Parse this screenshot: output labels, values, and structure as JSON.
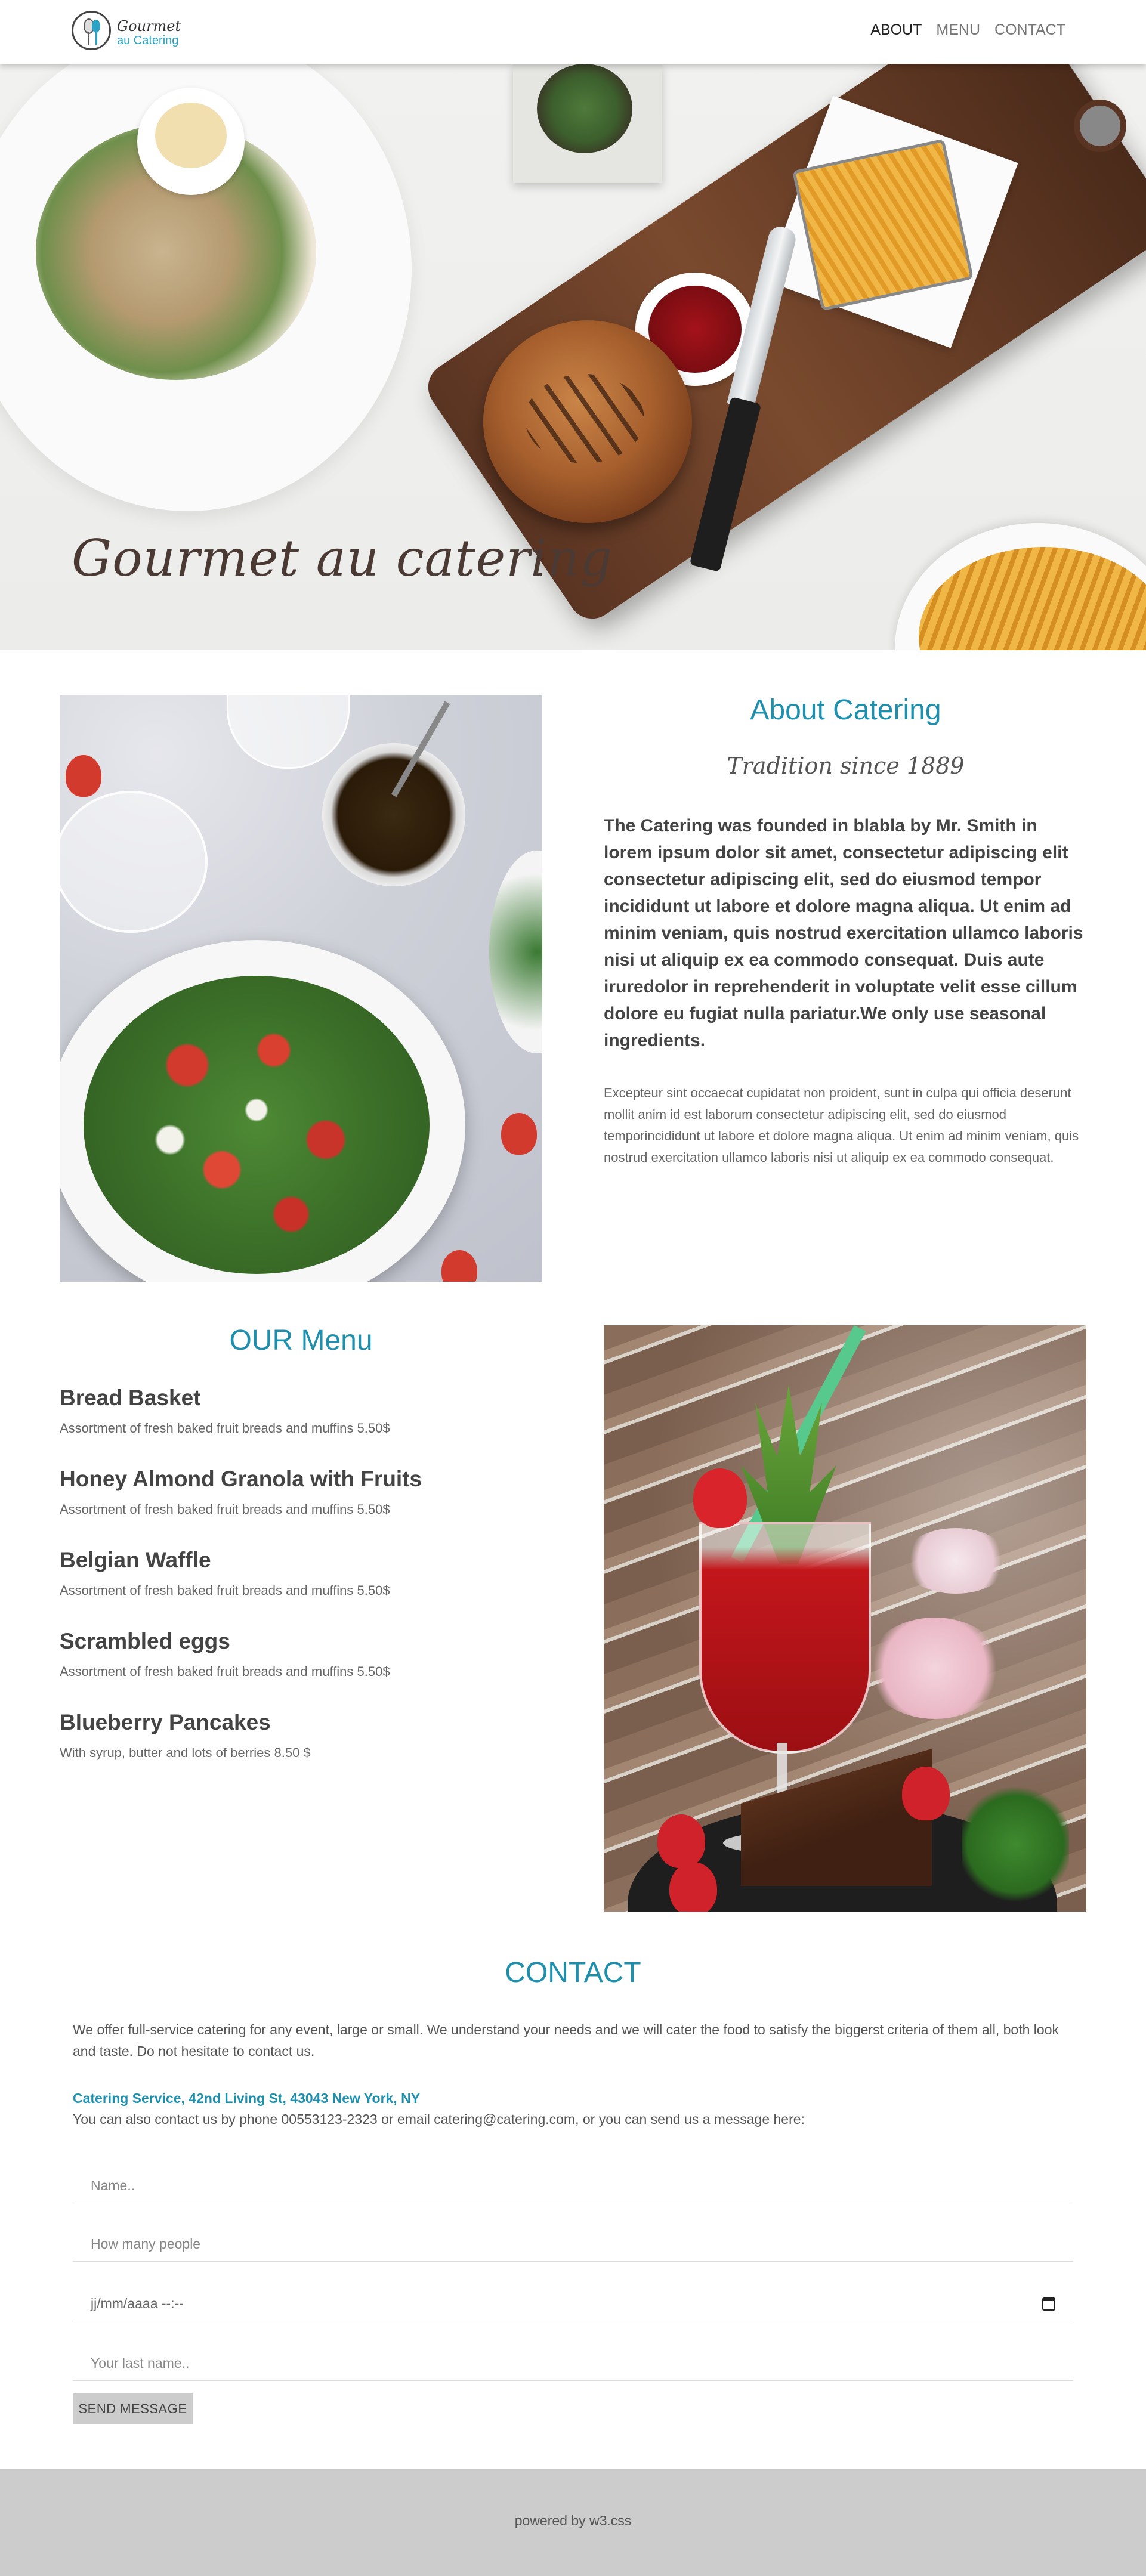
{
  "navbar": {
    "logo": {
      "line1": "Gourmet",
      "line2": "au Catering"
    },
    "links": [
      {
        "label": "ABOUT",
        "active": true
      },
      {
        "label": "MENU",
        "active": false
      },
      {
        "label": "CONTACT",
        "active": false
      }
    ]
  },
  "hero": {
    "title": "Gourmet au catering"
  },
  "about": {
    "title": "About Catering",
    "subtitle": "Tradition since 1889",
    "bold_text": "The Catering was founded in blabla by Mr. Smith in lorem ipsum dolor sit amet, consectetur adipiscing elit consectetur adipiscing elit, sed do eiusmod tempor incididunt ut labore et dolore magna aliqua. Ut enim ad minim veniam, quis nostrud exercitation ullamco laboris nisi ut aliquip ex ea commodo consequat. Duis aute iruredolor in reprehenderit in voluptate velit esse cillum dolore eu fugiat nulla pariatur.We only use seasonal ingredients.",
    "small_text": "Excepteur sint occaecat cupidatat non proident, sunt in culpa qui officia deserunt mollit anim id est laborum consectetur adipiscing elit, sed do eiusmod temporincididunt ut labore et dolore magna aliqua. Ut enim ad minim veniam, quis nostrud exercitation ullamco laboris nisi ut aliquip ex ea commodo consequat."
  },
  "menu": {
    "title": "OUR Menu",
    "items": [
      {
        "name": "Bread Basket",
        "desc": "Assortment of fresh baked fruit breads and muffins 5.50$"
      },
      {
        "name": "Honey Almond Granola with Fruits",
        "desc": "Assortment of fresh baked fruit breads and muffins 5.50$"
      },
      {
        "name": "Belgian Waffle",
        "desc": "Assortment of fresh baked fruit breads and muffins 5.50$"
      },
      {
        "name": "Scrambled eggs",
        "desc": "Assortment of fresh baked fruit breads and muffins 5.50$"
      },
      {
        "name": "Blueberry Pancakes",
        "desc": "With syrup, butter and lots of berries 8.50 $"
      }
    ]
  },
  "contact": {
    "title": "CONTACT",
    "paragraph": "We offer full-service catering for any event, large or small. We understand your needs and we will cater the food to satisfy the biggerst criteria of them all, both look and taste. Do not hesitate to contact us.",
    "address": "Catering Service, 42nd Living St, 43043 New York, NY",
    "phone_line": "You can also contact us by phone 00553123-2323 or email catering@catering.com, or you can send us a message here:",
    "form": {
      "name_placeholder": "Name..",
      "people_placeholder": "How many people",
      "date_placeholder": "jj/mm/aaaa --:--",
      "lastname_placeholder": "Your last name..",
      "submit_label": "SEND MESSAGE"
    }
  },
  "footer": {
    "text": "powered by w3.css"
  },
  "colors": {
    "accent": "#1f8fae",
    "footer_bg": "#cccccc",
    "button_bg": "#cccccc"
  }
}
